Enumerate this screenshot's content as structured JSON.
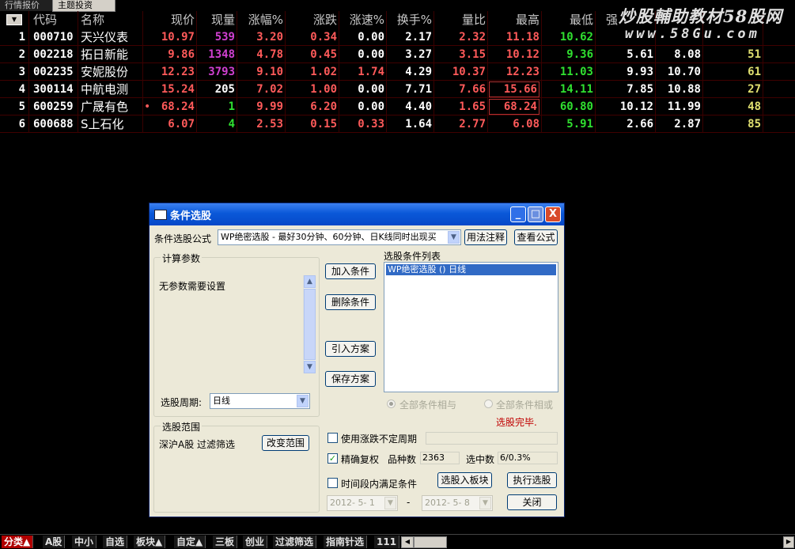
{
  "top_tabs": [
    "行情报价",
    "主题投资"
  ],
  "watermark": {
    "line1": "炒股輔助教材58股网",
    "line2": "www.58Gu.com"
  },
  "table": {
    "sort_arrow": "▼",
    "headers": [
      "代码",
      "名称",
      "现价",
      "现量",
      "涨幅%",
      "涨跌",
      "涨速%",
      "换手%",
      "量比",
      "最高",
      "最低",
      "强"
    ],
    "rows": [
      {
        "no": "1",
        "code": "000710",
        "name": "天兴仪表",
        "mark": "",
        "price": "10.97",
        "vol": "539",
        "pct": "3.20",
        "chg": "0.34",
        "speed": "0.00",
        "turnover": "2.17",
        "ratio": "2.32",
        "high": "11.18",
        "low": "10.62",
        "c1": "",
        "c2": "",
        "c3": ""
      },
      {
        "no": "2",
        "code": "002218",
        "name": "拓日新能",
        "mark": "",
        "price": "9.86",
        "vol": "1348",
        "pct": "4.78",
        "chg": "0.45",
        "speed": "0.00",
        "turnover": "3.27",
        "ratio": "3.15",
        "high": "10.12",
        "low": "9.36",
        "c1": "5.61",
        "c2": "8.08",
        "c3": "51"
      },
      {
        "no": "3",
        "code": "002235",
        "name": "安妮股份",
        "mark": "",
        "price": "12.23",
        "vol": "3793",
        "pct": "9.10",
        "chg": "1.02",
        "speed": "1.74",
        "turnover": "4.29",
        "ratio": "10.37",
        "high": "12.23",
        "low": "11.03",
        "c1": "9.93",
        "c2": "10.70",
        "c3": "61"
      },
      {
        "no": "4",
        "code": "300114",
        "name": "中航电测",
        "mark": "",
        "price": "15.24",
        "vol": "205",
        "pct": "7.02",
        "chg": "1.00",
        "speed": "0.00",
        "turnover": "7.71",
        "ratio": "7.66",
        "high": "15.66",
        "low": "14.11",
        "c1": "7.85",
        "c2": "10.88",
        "c3": "27"
      },
      {
        "no": "5",
        "code": "600259",
        "name": "广晟有色",
        "mark": "•",
        "price": "68.24",
        "vol": "1",
        "pct": "9.99",
        "chg": "6.20",
        "speed": "0.00",
        "turnover": "4.40",
        "ratio": "1.65",
        "high": "68.24",
        "low": "60.80",
        "c1": "10.12",
        "c2": "11.99",
        "c3": "48"
      },
      {
        "no": "6",
        "code": "600688",
        "name": "S上石化",
        "mark": "",
        "price": "6.07",
        "vol": "4",
        "pct": "2.53",
        "chg": "0.15",
        "speed": "0.33",
        "turnover": "1.64",
        "ratio": "2.77",
        "high": "6.08",
        "low": "5.91",
        "c1": "2.66",
        "c2": "2.87",
        "c3": "85"
      }
    ]
  },
  "dialog": {
    "title": "条件选股",
    "win_buttons": {
      "min": "_",
      "max": "□",
      "close": "X"
    },
    "formula_label": "条件选股公式",
    "formula_value": "WP绝密选股 - 最好30分钟、60分钟、日K线同时出现买",
    "usage_btn": "用法注释",
    "view_btn": "查看公式",
    "params_title": "计算参数",
    "params_text": "无参数需要设置",
    "period_label": "选股周期:",
    "period_value": "日线",
    "add_btn": "加入条件",
    "del_btn": "删除条件",
    "import_btn": "引入方案",
    "save_btn": "保存方案",
    "list_title": "选股条件列表",
    "list_item": "WP绝密选股 () 日线",
    "radio_and": "全部条件相与",
    "radio_or": "全部条件相或",
    "status": "选股完毕.",
    "range_title": "选股范围",
    "range_text": "深沪A股 过滤筛选",
    "range_btn": "改变范围",
    "use_period_label": "使用涨跌不定周期",
    "adjust_label": "精确复权",
    "count_label": "品种数",
    "count_value": "2363",
    "selected_label": "选中数",
    "selected_value": "6/0.3%",
    "to_block_btn": "选股入板块",
    "run_btn": "执行选股",
    "timespan_label": "时间段内满足条件",
    "date_from": "2012- 5- 1",
    "date_sep": "-",
    "date_to": "2012- 5- 8",
    "close_btn": "关闭"
  },
  "bottom_tabs": [
    "分类▲",
    "A股",
    "中小",
    "自选",
    "板块▲",
    "自定▲",
    "三板",
    "创业",
    "过滤筛选",
    "指南针选",
    "111"
  ],
  "bottom_nav": [
    "◀",
    "▶"
  ]
}
